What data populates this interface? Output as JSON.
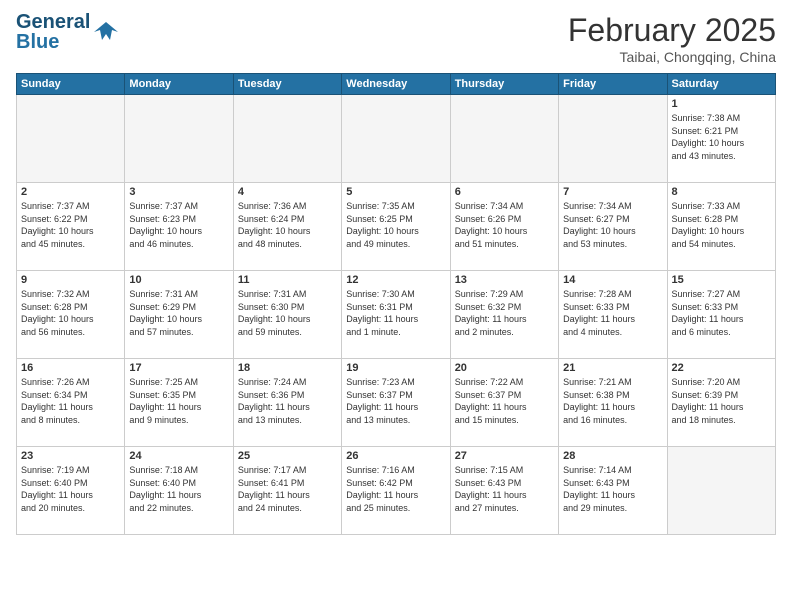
{
  "header": {
    "logo_line1": "General",
    "logo_line2": "Blue",
    "month_title": "February 2025",
    "subtitle": "Taibai, Chongqing, China"
  },
  "days_of_week": [
    "Sunday",
    "Monday",
    "Tuesday",
    "Wednesday",
    "Thursday",
    "Friday",
    "Saturday"
  ],
  "weeks": [
    [
      {
        "day": "",
        "info": ""
      },
      {
        "day": "",
        "info": ""
      },
      {
        "day": "",
        "info": ""
      },
      {
        "day": "",
        "info": ""
      },
      {
        "day": "",
        "info": ""
      },
      {
        "day": "",
        "info": ""
      },
      {
        "day": "1",
        "info": "Sunrise: 7:38 AM\nSunset: 6:21 PM\nDaylight: 10 hours\nand 43 minutes."
      }
    ],
    [
      {
        "day": "2",
        "info": "Sunrise: 7:37 AM\nSunset: 6:22 PM\nDaylight: 10 hours\nand 45 minutes."
      },
      {
        "day": "3",
        "info": "Sunrise: 7:37 AM\nSunset: 6:23 PM\nDaylight: 10 hours\nand 46 minutes."
      },
      {
        "day": "4",
        "info": "Sunrise: 7:36 AM\nSunset: 6:24 PM\nDaylight: 10 hours\nand 48 minutes."
      },
      {
        "day": "5",
        "info": "Sunrise: 7:35 AM\nSunset: 6:25 PM\nDaylight: 10 hours\nand 49 minutes."
      },
      {
        "day": "6",
        "info": "Sunrise: 7:34 AM\nSunset: 6:26 PM\nDaylight: 10 hours\nand 51 minutes."
      },
      {
        "day": "7",
        "info": "Sunrise: 7:34 AM\nSunset: 6:27 PM\nDaylight: 10 hours\nand 53 minutes."
      },
      {
        "day": "8",
        "info": "Sunrise: 7:33 AM\nSunset: 6:28 PM\nDaylight: 10 hours\nand 54 minutes."
      }
    ],
    [
      {
        "day": "9",
        "info": "Sunrise: 7:32 AM\nSunset: 6:28 PM\nDaylight: 10 hours\nand 56 minutes."
      },
      {
        "day": "10",
        "info": "Sunrise: 7:31 AM\nSunset: 6:29 PM\nDaylight: 10 hours\nand 57 minutes."
      },
      {
        "day": "11",
        "info": "Sunrise: 7:31 AM\nSunset: 6:30 PM\nDaylight: 10 hours\nand 59 minutes."
      },
      {
        "day": "12",
        "info": "Sunrise: 7:30 AM\nSunset: 6:31 PM\nDaylight: 11 hours\nand 1 minute."
      },
      {
        "day": "13",
        "info": "Sunrise: 7:29 AM\nSunset: 6:32 PM\nDaylight: 11 hours\nand 2 minutes."
      },
      {
        "day": "14",
        "info": "Sunrise: 7:28 AM\nSunset: 6:33 PM\nDaylight: 11 hours\nand 4 minutes."
      },
      {
        "day": "15",
        "info": "Sunrise: 7:27 AM\nSunset: 6:33 PM\nDaylight: 11 hours\nand 6 minutes."
      }
    ],
    [
      {
        "day": "16",
        "info": "Sunrise: 7:26 AM\nSunset: 6:34 PM\nDaylight: 11 hours\nand 8 minutes."
      },
      {
        "day": "17",
        "info": "Sunrise: 7:25 AM\nSunset: 6:35 PM\nDaylight: 11 hours\nand 9 minutes."
      },
      {
        "day": "18",
        "info": "Sunrise: 7:24 AM\nSunset: 6:36 PM\nDaylight: 11 hours\nand 13 minutes."
      },
      {
        "day": "19",
        "info": "Sunrise: 7:23 AM\nSunset: 6:37 PM\nDaylight: 11 hours\nand 13 minutes."
      },
      {
        "day": "20",
        "info": "Sunrise: 7:22 AM\nSunset: 6:37 PM\nDaylight: 11 hours\nand 15 minutes."
      },
      {
        "day": "21",
        "info": "Sunrise: 7:21 AM\nSunset: 6:38 PM\nDaylight: 11 hours\nand 16 minutes."
      },
      {
        "day": "22",
        "info": "Sunrise: 7:20 AM\nSunset: 6:39 PM\nDaylight: 11 hours\nand 18 minutes."
      }
    ],
    [
      {
        "day": "23",
        "info": "Sunrise: 7:19 AM\nSunset: 6:40 PM\nDaylight: 11 hours\nand 20 minutes."
      },
      {
        "day": "24",
        "info": "Sunrise: 7:18 AM\nSunset: 6:40 PM\nDaylight: 11 hours\nand 22 minutes."
      },
      {
        "day": "25",
        "info": "Sunrise: 7:17 AM\nSunset: 6:41 PM\nDaylight: 11 hours\nand 24 minutes."
      },
      {
        "day": "26",
        "info": "Sunrise: 7:16 AM\nSunset: 6:42 PM\nDaylight: 11 hours\nand 25 minutes."
      },
      {
        "day": "27",
        "info": "Sunrise: 7:15 AM\nSunset: 6:43 PM\nDaylight: 11 hours\nand 27 minutes."
      },
      {
        "day": "28",
        "info": "Sunrise: 7:14 AM\nSunset: 6:43 PM\nDaylight: 11 hours\nand 29 minutes."
      },
      {
        "day": "",
        "info": ""
      }
    ]
  ]
}
